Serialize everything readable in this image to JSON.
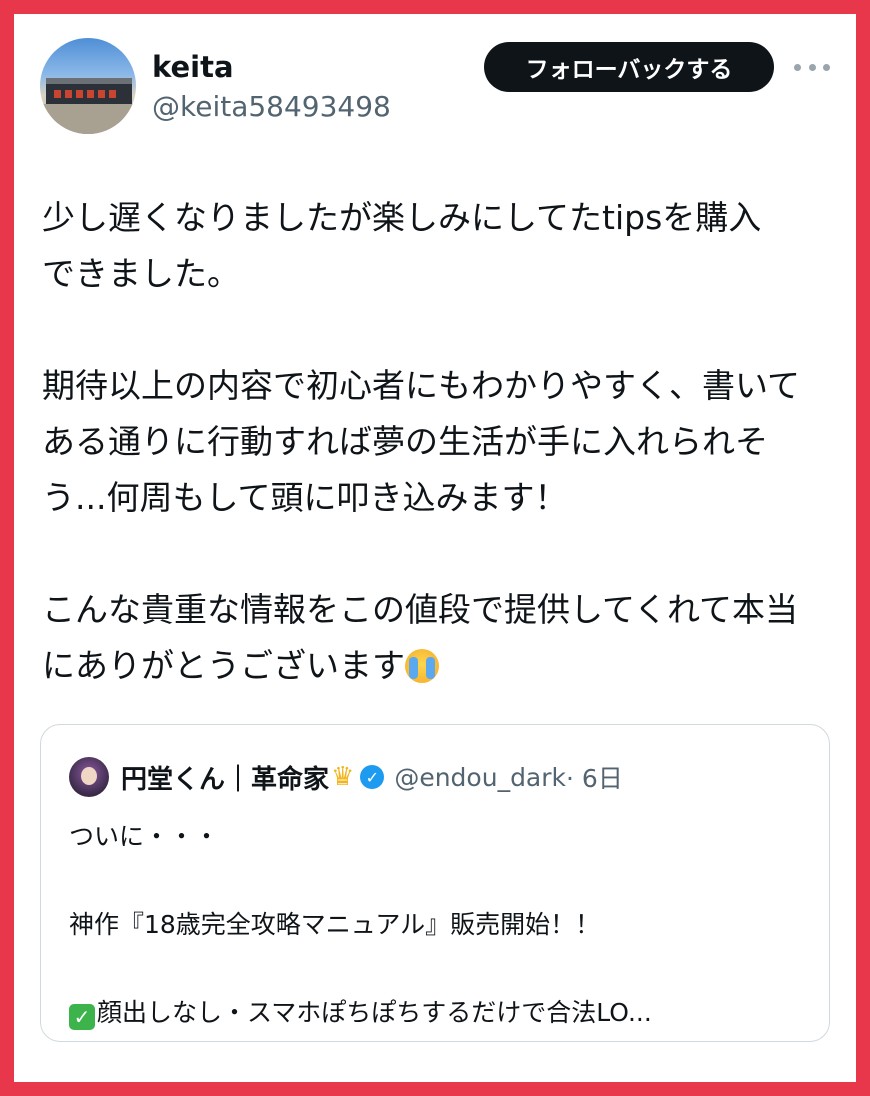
{
  "post": {
    "author_name": "keita",
    "author_handle": "@keita58493498",
    "follow_button_label": "フォローバックする",
    "more_icon": "more-horizontal-icon",
    "paragraphs": [
      [
        "少し遅くなりましたが楽しみにしてたtipsを購入",
        "できました。"
      ],
      [
        "期待以上の内容で初心者にもわかりやすく、書いて",
        "ある通りに行動すれば夢の生活が手に入れられそ",
        "う...何周もして頭に叩き込みます！"
      ],
      [
        "こんな貴重な情報をこの値段で提供してくれて本当",
        "にありがとうございます"
      ]
    ],
    "trailing_emoji": "loudly-crying-face-emoji"
  },
  "quoted_post": {
    "author_name": "円堂くん｜革命家",
    "name_emoji": "crown-icon",
    "verified_icon": "verified-badge-icon",
    "author_handle": "@endou_dark",
    "time": "· 6日",
    "lines": [
      "ついに・・・",
      "神作『18歳完全攻略マニュアル』販売開始！！",
      "顔出しなし・スマホぽちぽちするだけで合法LO..."
    ],
    "check_icon": "check-mark-button-icon"
  },
  "colors": {
    "frame": "#e8364a",
    "button_bg": "#0f1419",
    "secondary_text": "#536471",
    "verified": "#1d9bf0"
  }
}
